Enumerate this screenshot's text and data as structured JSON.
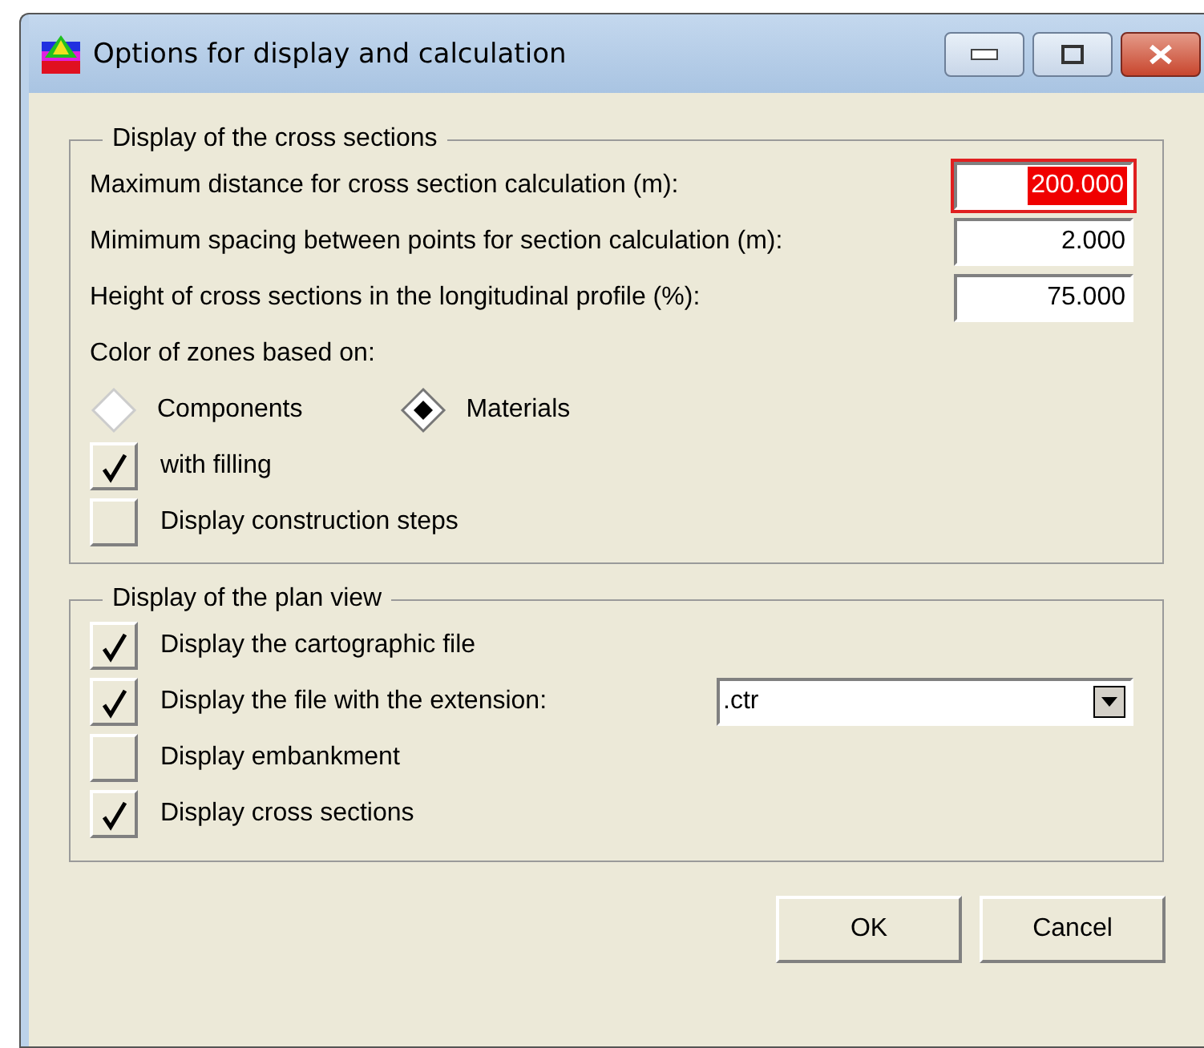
{
  "window": {
    "title": "Options for display and calculation"
  },
  "window_controls": [
    {
      "kind": "minimize"
    },
    {
      "kind": "maximize"
    },
    {
      "kind": "close"
    }
  ],
  "cross_sections": {
    "title": "Display of the cross sections",
    "fields": [
      {
        "label": "Maximum distance for cross section calculation (m):",
        "value": "200.000",
        "focused": true
      },
      {
        "label": "Mimimum spacing between points for section calculation (m):",
        "value": "2.000",
        "focused": false
      },
      {
        "label": "Height of cross sections in the longitudinal profile (%):",
        "value": "75.000",
        "focused": false
      }
    ],
    "color_label": "Color of zones based on:",
    "color_options": [
      {
        "label": "Components",
        "selected": false
      },
      {
        "label": "Materials",
        "selected": true
      }
    ],
    "checks": [
      {
        "label": "with filling",
        "checked": true
      },
      {
        "label": "Display construction steps",
        "checked": false
      }
    ]
  },
  "plan_view": {
    "title": "Display of the plan view",
    "checks": [
      {
        "label": "Display the cartographic file",
        "checked": true
      },
      {
        "label": "Display the file with the extension:",
        "checked": true,
        "dropdown": ".ctr"
      },
      {
        "label": "Display embankment",
        "checked": false
      },
      {
        "label": "Display cross sections",
        "checked": true
      }
    ]
  },
  "buttons": [
    "OK",
    "Cancel"
  ]
}
